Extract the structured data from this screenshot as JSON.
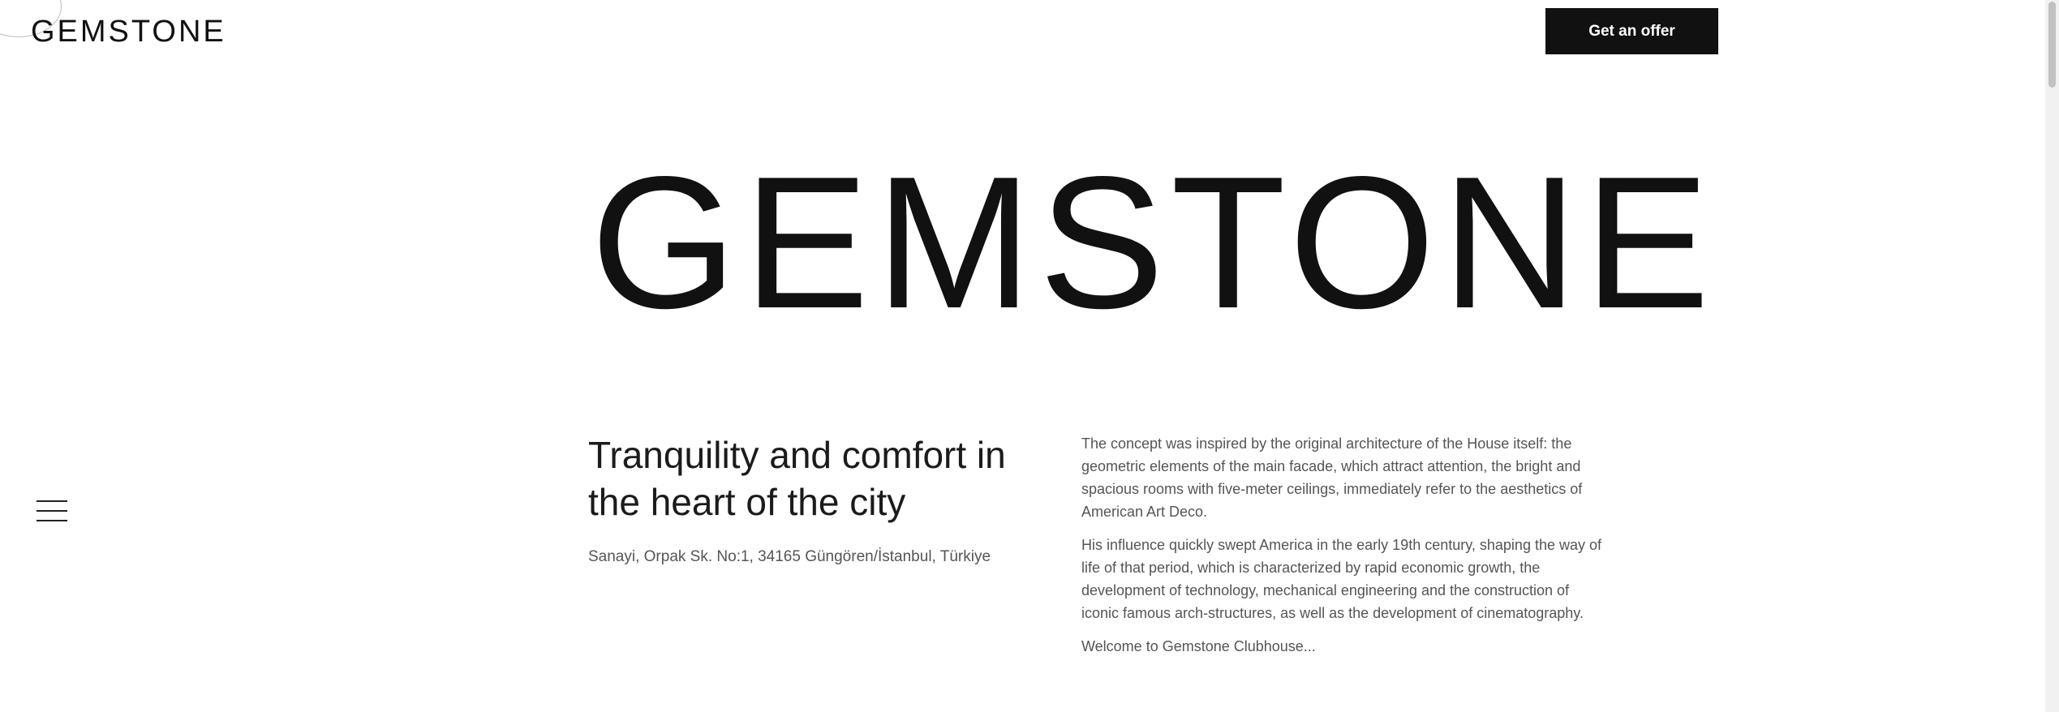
{
  "header": {
    "logo": "GEMSTONE",
    "offer_button": "Get an offer"
  },
  "hero": {
    "title": "GEMSTONE"
  },
  "intro": {
    "tagline": "Tranquility and comfort in the heart of the city",
    "address": "Sanayi, Orpak Sk. No:1, 34165 Güngören/İstanbul, Türkiye"
  },
  "description": {
    "paragraph1": "The concept was inspired by the original architecture of the House itself: the geometric elements of the main facade, which attract attention, the bright and spacious rooms with five-meter ceilings, immediately refer to the aesthetics of American Art Deco.",
    "paragraph2": "His influence quickly swept America in the early 19th century, shaping the way of life of that period, which is characterized by rapid economic growth, the development of technology, mechanical engineering and the construction of iconic famous arch-structures, as well as the development of cinematography.",
    "paragraph3": "Welcome to Gemstone Clubhouse..."
  },
  "icons": {
    "menu": "hamburger-menu-icon"
  }
}
